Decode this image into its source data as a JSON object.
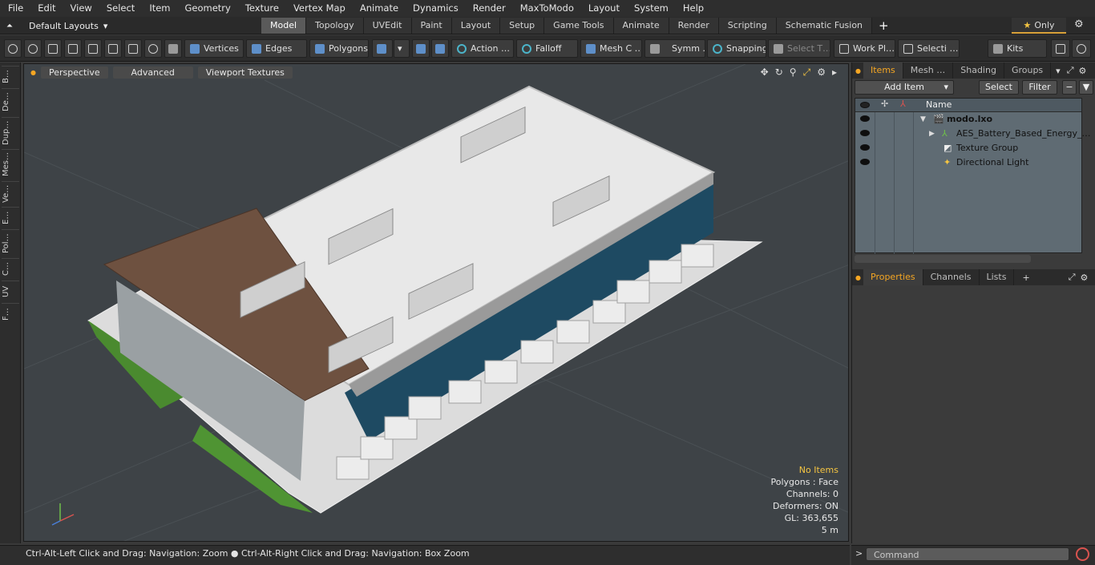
{
  "menu": [
    "File",
    "Edit",
    "View",
    "Select",
    "Item",
    "Geometry",
    "Texture",
    "Vertex Map",
    "Animate",
    "Dynamics",
    "Render",
    "MaxToModo",
    "Layout",
    "System",
    "Help"
  ],
  "layout": {
    "label": "Default Layouts",
    "arrow": "▾"
  },
  "tabs": [
    "Model",
    "Topology",
    "UVEdit",
    "Paint",
    "Layout",
    "Setup",
    "Game Tools",
    "Animate",
    "Render",
    "Scripting",
    "Schematic Fusion"
  ],
  "active_tab": "Model",
  "only_label": "Only",
  "toolbar": {
    "vertices": "Vertices",
    "edges": "Edges",
    "polygons": "Polygons",
    "action": "Action …",
    "falloff": "Falloff",
    "mesh": "Mesh C …",
    "symm": "Symm …",
    "snapping": "Snapping",
    "select_t": "Select T…",
    "work_pl": "Work Pl…",
    "selecti": "Selecti …",
    "kits": "Kits"
  },
  "left_tabs": [
    "B…",
    "De…",
    "Dup…",
    "Mes…",
    "Ve…",
    "E…",
    "Pol…",
    "C…",
    "UV",
    "F…"
  ],
  "viewport": {
    "perspective": "Perspective",
    "advanced": "Advanced",
    "textures": "Viewport Textures"
  },
  "hud": {
    "no_items": "No Items",
    "polygons": "Polygons : Face",
    "channels": "Channels: 0",
    "deformers": "Deformers: ON",
    "gl": "GL: 363,655",
    "scale": "5 m"
  },
  "items_panel": {
    "tabs": [
      "Items",
      "Mesh …",
      "Shading",
      "Groups"
    ],
    "add_item": "Add Item",
    "select": "Select",
    "filter": "Filter",
    "name_col": "Name",
    "rows": [
      {
        "label": "modo.lxo",
        "bold": true
      },
      {
        "label": "AES_Battery_Based_Energy_…"
      },
      {
        "label": "Texture Group"
      },
      {
        "label": "Directional Light"
      }
    ]
  },
  "properties_panel": {
    "tabs": [
      "Properties",
      "Channels",
      "Lists"
    ]
  },
  "status": "Ctrl-Alt-Left Click and Drag: Navigation: Zoom ● Ctrl-Alt-Right Click and Drag: Navigation: Box Zoom",
  "command_placeholder": "Command",
  "colors": {
    "accent": "#f5a623",
    "viewport_bg": "#3e4347",
    "panel": "#3b3b3b"
  }
}
